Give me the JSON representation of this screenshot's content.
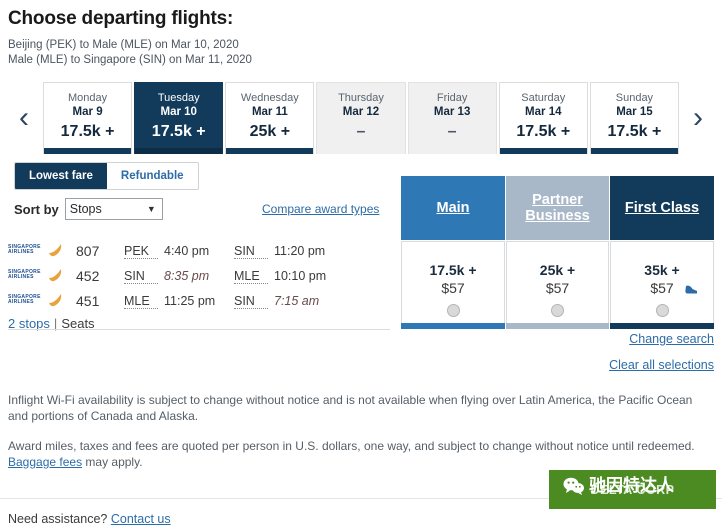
{
  "header": {
    "title": "Choose departing flights:",
    "routes": [
      "Beijing (PEK) to Male (MLE) on Mar 10, 2020",
      "Male (MLE) to Singapore (SIN) on Mar 11, 2020"
    ]
  },
  "date_strip": {
    "prev_icon": "chevron-left-icon",
    "next_icon": "chevron-right-icon",
    "days": [
      {
        "dow": "Monday",
        "date": "Mar 9",
        "price": "17.5k +",
        "selected": false,
        "available": true
      },
      {
        "dow": "Tuesday",
        "date": "Mar 10",
        "price": "17.5k +",
        "selected": true,
        "available": true
      },
      {
        "dow": "Wednesday",
        "date": "Mar 11",
        "price": "25k +",
        "selected": false,
        "available": true
      },
      {
        "dow": "Thursday",
        "date": "Mar 12",
        "price": "–",
        "selected": false,
        "available": false
      },
      {
        "dow": "Friday",
        "date": "Mar 13",
        "price": "–",
        "selected": false,
        "available": false
      },
      {
        "dow": "Saturday",
        "date": "Mar 14",
        "price": "17.5k +",
        "selected": false,
        "available": true
      },
      {
        "dow": "Sunday",
        "date": "Mar 15",
        "price": "17.5k +",
        "selected": false,
        "available": true
      }
    ]
  },
  "controls": {
    "fare_toggle": {
      "selected": "Lowest fare",
      "other": "Refundable"
    },
    "sort_label": "Sort by",
    "sort_value": "Stops",
    "sort_options": [
      "Stops"
    ],
    "compare_link": "Compare award types"
  },
  "cabins": [
    {
      "label": "Main",
      "color": "#2e79b5"
    },
    {
      "label": "Partner Business",
      "color": "#a8b8c8"
    },
    {
      "label": "First Class",
      "color": "#123a5a"
    }
  ],
  "flight": {
    "airline": "SINGAPORE AIRLINES",
    "legs": [
      {
        "number": "807",
        "from": "PEK",
        "depart": "4:40 pm",
        "depart_next": false,
        "to": "SIN",
        "arrive": "11:20 pm",
        "arrive_next": false
      },
      {
        "number": "452",
        "from": "SIN",
        "depart": "8:35 pm",
        "depart_next": true,
        "to": "MLE",
        "arrive": "10:10 pm",
        "arrive_next": false
      },
      {
        "number": "451",
        "from": "MLE",
        "depart": "11:25 pm",
        "depart_next": false,
        "to": "SIN",
        "arrive": "7:15 am",
        "arrive_next": true
      }
    ],
    "stops": "2 stops",
    "separator": "|",
    "seats": "Seats"
  },
  "fares": [
    {
      "miles": "17.5k +",
      "cash": "$57",
      "bar_color": "#2e79b5",
      "seat_icon": false
    },
    {
      "miles": "25k +",
      "cash": "$57",
      "bar_color": "#a8b8c8",
      "seat_icon": false
    },
    {
      "miles": "35k +",
      "cash": "$57",
      "bar_color": "#123a5a",
      "seat_icon": true
    }
  ],
  "right_links": {
    "change_search": "Change search",
    "clear_selections": "Clear all selections"
  },
  "disclaimers": {
    "wifi": "Inflight Wi-Fi availability is subject to change without notice and is not available when flying over Latin America, the Pacific Ocean and portions of Canada and Alaska.",
    "award_prefix": "Award miles, taxes and fees are quoted per person in U.S. dollars, one way, and subject to change without notice until redeemed.",
    "baggage_link": "Baggage fees",
    "baggage_suffix": " may apply."
  },
  "footer": {
    "assistance": "Need assistance?",
    "contact_link": "Contact us"
  },
  "overlay": {
    "button_text": "DELTA CORP",
    "button_color": "#4b8b22",
    "watermark_text": "驰因特达人",
    "watermark_icon": "wechat-icon"
  }
}
